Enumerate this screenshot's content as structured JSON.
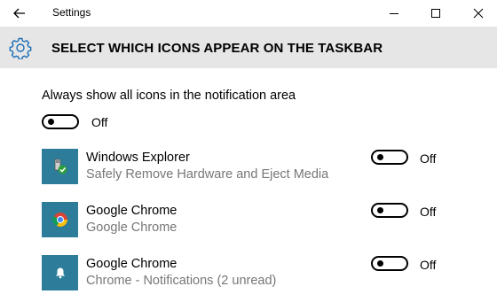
{
  "window": {
    "title": "Settings"
  },
  "header": {
    "title": "SELECT WHICH ICONS APPEAR ON THE TASKBAR"
  },
  "always_show": {
    "label": "Always show all icons in the notification area",
    "state": "Off"
  },
  "apps": [
    {
      "name": "Windows Explorer",
      "description": "Safely Remove Hardware and Eject Media",
      "state": "Off",
      "icon": "usb-eject-icon"
    },
    {
      "name": "Google Chrome",
      "description": "Google Chrome",
      "state": "Off",
      "icon": "chrome-icon"
    },
    {
      "name": "Google Chrome",
      "description": "Chrome - Notifications (2 unread)",
      "state": "Off",
      "icon": "bell-icon"
    }
  ],
  "colors": {
    "header_bg": "#e6e6e6",
    "icon_tile": "#2d7d9a",
    "accent": "#0078d7",
    "secondary_text": "#777777"
  }
}
